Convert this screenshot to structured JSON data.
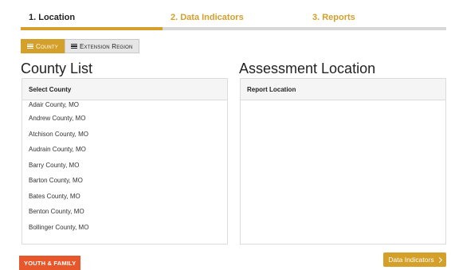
{
  "steps": [
    {
      "label": "1. Location"
    },
    {
      "label": "2. Data Indicators"
    },
    {
      "label": "3. Reports"
    }
  ],
  "progress": {
    "fraction": 0.334
  },
  "toggle": {
    "county": "County",
    "extension_region": "Extension Region"
  },
  "county_list": {
    "title": "County List",
    "header": "Select County",
    "items": [
      "Adair County, MO",
      "Andrew County, MO",
      "Atchison County, MO",
      "Audrain County, MO",
      "Barry County, MO",
      "Barton County, MO",
      "Bates County, MO",
      "Benton County, MO",
      "Bollinger County, MO"
    ]
  },
  "assessment": {
    "title": "Assessment Location",
    "header": "Report Location"
  },
  "footer": {
    "badge": "YOUTH & FAMILY",
    "next_button": "Data Indicators"
  },
  "colors": {
    "accent": "#d4a02a",
    "badge": "#e8572b"
  },
  "icons": {
    "toggle": "list-icon",
    "next": "chevron-right-icon"
  }
}
